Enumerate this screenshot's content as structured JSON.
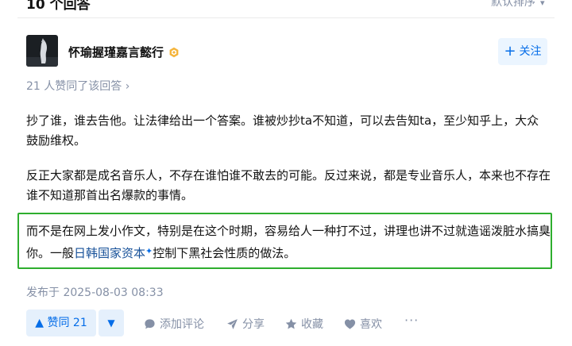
{
  "header": {
    "answer_count": "10 个回答",
    "sort_label": "默认排序"
  },
  "author": {
    "name": "怀瑜握瑾嘉言懿行",
    "follow_label": "关注"
  },
  "upvote_summary": "21 人赞同了该回答 ›",
  "content": {
    "p1": "抄了谁，谁去告他。让法律给出一个答案。谁被炒抄ta不知道，可以去告知ta，至少知乎上，大众鼓励维权。",
    "p2": "反正大家都是成名音乐人，不存在谁怕谁不敢去的可能。反过来说，都是专业音乐人，本来也不存在谁不知道那首出名爆款的事情。",
    "p3_before": "而不是在网上发小作文，特别是在这个时期，容易给人一种打不过，讲理也讲不过就造谣泼脏水搞臭你。一般",
    "p3_link": "日韩国家资本",
    "p3_after": "控制下黑社会性质的做法。"
  },
  "published": "发布于 2025-08-03 08:33",
  "actions": {
    "upvote_label": "▲ 赞同 21",
    "downvote_label": "▼",
    "comment_label": "添加评论",
    "share_label": "分享",
    "favorite_label": "收藏",
    "like_label": "喜欢",
    "more_label": "···"
  },
  "colors": {
    "primary": "#056de8",
    "muted": "#8590a6",
    "highlight_border": "#2eae2e"
  },
  "icons": [
    "chevron-down-icon",
    "author-badge-icon",
    "comment-icon",
    "share-icon",
    "star-icon",
    "heart-icon"
  ]
}
